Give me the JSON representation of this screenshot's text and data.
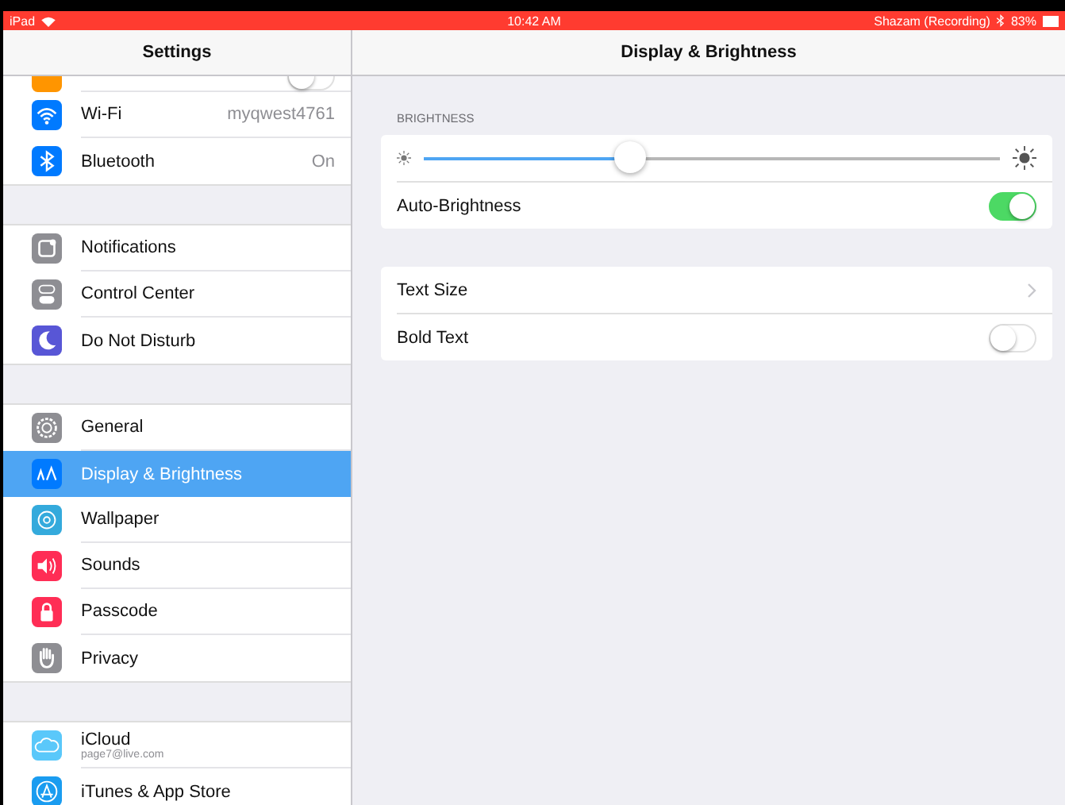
{
  "status_bar": {
    "device": "iPad",
    "time": "10:42 AM",
    "recording": "Shazam (Recording)",
    "battery": "83%"
  },
  "sidebar": {
    "title": "Settings",
    "groups": [
      [
        {
          "color": "#ff9500",
          "kind": "toggle",
          "on": false
        },
        {
          "label": "Wi-Fi",
          "value": "myqwest4761",
          "color": "#007aff",
          "selected": false
        },
        {
          "label": "Bluetooth",
          "value": "On",
          "color": "#007aff",
          "selected": false
        }
      ],
      [
        {
          "label": "Notifications",
          "color": "#8e8e93",
          "selected": false
        },
        {
          "label": "Control Center",
          "color": "#8e8e93",
          "selected": false
        },
        {
          "label": "Do Not Disturb",
          "color": "#5856d6",
          "selected": false
        }
      ],
      [
        {
          "label": "General",
          "color": "#8e8e93",
          "selected": false
        },
        {
          "label": "Display & Brightness",
          "color": "#007aff",
          "selected": true
        },
        {
          "label": "Wallpaper",
          "color": "#34aadc",
          "selected": false
        },
        {
          "label": "Sounds",
          "color": "#ff2d55",
          "selected": false
        },
        {
          "label": "Passcode",
          "color": "#ff2d55",
          "selected": false
        },
        {
          "label": "Privacy",
          "color": "#8e8e93",
          "selected": false
        }
      ],
      [
        {
          "label": "iCloud",
          "subtitle": "page7@live.com",
          "color": "#5ac8fa",
          "selected": false
        },
        {
          "label": "iTunes & App Store",
          "color": "#1a9cf0",
          "selected": false
        }
      ]
    ]
  },
  "detail": {
    "title": "Display & Brightness",
    "section_header": "BRIGHTNESS",
    "groups": [
      [
        {
          "kind": "slider",
          "level": 0.36
        },
        {
          "kind": "toggle",
          "label": "Auto-Brightness",
          "on": true
        }
      ],
      [
        {
          "kind": "link",
          "label": "Text Size"
        },
        {
          "kind": "toggle",
          "label": "Bold Text",
          "on": false
        }
      ]
    ]
  }
}
